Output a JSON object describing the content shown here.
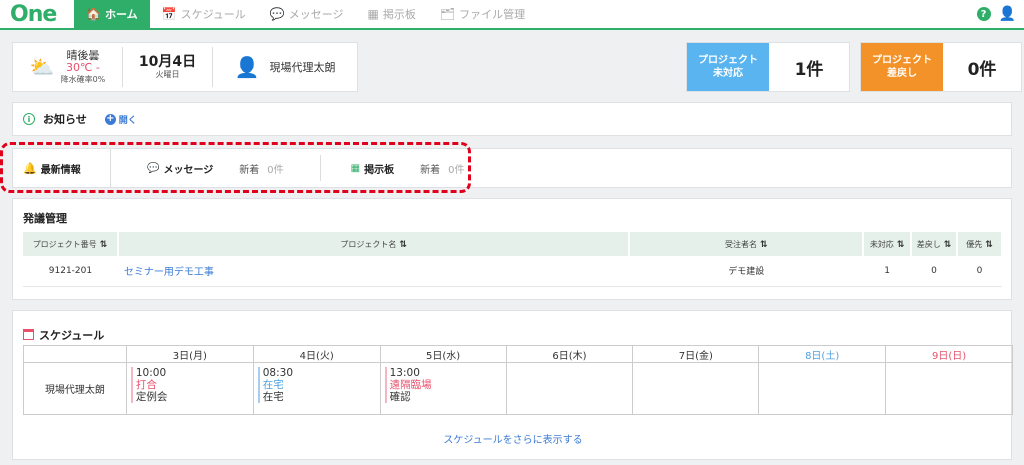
{
  "nav": {
    "logo": "One",
    "tabs": [
      {
        "label": "ホーム",
        "icon": "home-icon"
      },
      {
        "label": "スケジュール",
        "icon": "calendar-icon"
      },
      {
        "label": "メッセージ",
        "icon": "message-icon"
      },
      {
        "label": "掲示板",
        "icon": "board-icon"
      },
      {
        "label": "ファイル管理",
        "icon": "file-icon"
      }
    ],
    "help": "?"
  },
  "weather": {
    "title": "晴後曇",
    "temp": "30℃ -",
    "rain": "降水確率0%",
    "icon": "sun-cloud-icon"
  },
  "date": {
    "day": "10月4日",
    "weekday": "火曜日"
  },
  "user": {
    "name": "現場代理太朗",
    "icon": "person-icon"
  },
  "stats": [
    {
      "label_line1": "プロジェクト",
      "label_line2": "未対応",
      "count": "1件",
      "color": "#5ab4ef"
    },
    {
      "label_line1": "プロジェクト",
      "label_line2": "差戻し",
      "count": "0件",
      "color": "#f4922a"
    }
  ],
  "notice": {
    "title": "お知らせ",
    "open": "開く"
  },
  "latest": {
    "title": "最新情報",
    "message": {
      "label": "メッセージ",
      "new": "新着",
      "count": "0件"
    },
    "board": {
      "label": "掲示板",
      "new": "新着",
      "count": "0件"
    }
  },
  "order": {
    "title": "発議管理",
    "columns": [
      "プロジェクト番号",
      "プロジェクト名",
      "受注者名",
      "未対応",
      "差戻し",
      "優先"
    ],
    "rows": [
      {
        "number": "9121-201",
        "name": "セミナー用デモ工事",
        "contractor": "デモ建設",
        "pending": "1",
        "returned": "0",
        "priority": "0"
      }
    ]
  },
  "schedule": {
    "title": "スケジュール",
    "days": [
      "3日(月)",
      "4日(火)",
      "5日(水)",
      "6日(木)",
      "7日(金)",
      "8日(土)",
      "9日(日)"
    ],
    "person": "現場代理太朗",
    "events": [
      {
        "time": "10:00",
        "name": "打合",
        "sub": "定例会"
      },
      {
        "time": "08:30",
        "name": "在宅",
        "sub": "在宅"
      },
      {
        "time": "13:00",
        "name": "遠隔臨場",
        "sub": "確認"
      }
    ],
    "more": "スケジュールをさらに表示する",
    "colors": {
      "saturday": "#4ea1e0",
      "sunday": "#e8506b"
    }
  },
  "colors": {
    "brand": "#2eae68",
    "link": "#3b7bd5",
    "highlight": "#e0001b"
  }
}
